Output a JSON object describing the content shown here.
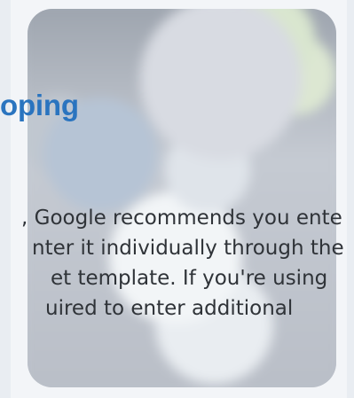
{
  "heading": "oping",
  "body_lines": [
    ", Google recommends you ente",
    "nter it individually through the",
    "et template. If you're using",
    "uired to enter additional"
  ],
  "colors": {
    "heading": "#2a74bf",
    "text": "#2f3338"
  },
  "icon_names": [
    "blurred-background-image"
  ]
}
